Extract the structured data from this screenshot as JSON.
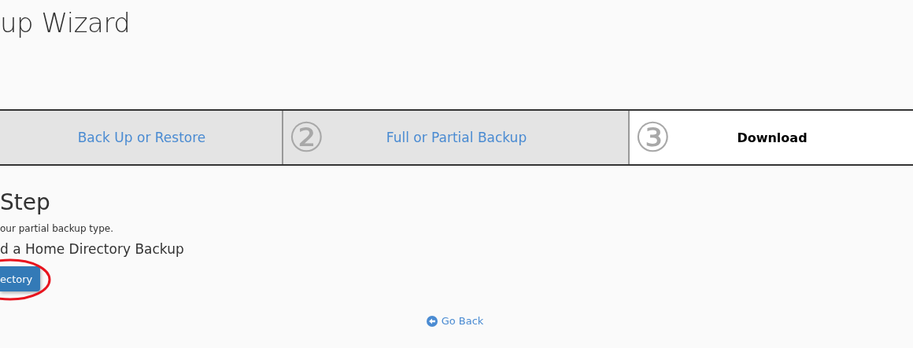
{
  "page_title": "up Wizard",
  "steps": [
    {
      "label": "Back Up or Restore",
      "selected": false
    },
    {
      "number": "②",
      "label": "Full or Partial Backup",
      "selected": false
    },
    {
      "number": "③",
      "label": "Download",
      "selected": true
    }
  ],
  "section_heading": "Step",
  "instruction": "our partial backup type.",
  "subheading": "d a Home Directory Backup",
  "button": {
    "label": "ectory",
    "highlighted": true
  },
  "go_back": "Go Back"
}
